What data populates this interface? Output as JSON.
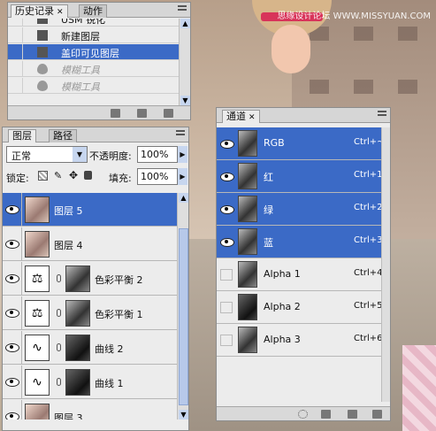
{
  "watermark": "思缘设计论坛 WWW.MISSYUAN.COM",
  "history": {
    "tabs": [
      "历史记录",
      "动作"
    ],
    "items": [
      {
        "label": "USM 锐化",
        "state": "normal"
      },
      {
        "label": "新建图层",
        "state": "normal"
      },
      {
        "label": "盖印可见图层",
        "state": "selected"
      },
      {
        "label": "模糊工具",
        "state": "dim"
      },
      {
        "label": "模糊工具",
        "state": "dim"
      }
    ]
  },
  "layers": {
    "tabs": [
      "图层",
      "路径"
    ],
    "blend_mode": "正常",
    "opacity_label": "不透明度:",
    "opacity_value": "100%",
    "lock_label": "锁定:",
    "fill_label": "填充:",
    "fill_value": "100%",
    "items": [
      {
        "name": "图层 5",
        "type": "photo",
        "selected": true
      },
      {
        "name": "图层 4",
        "type": "photo",
        "selected": false
      },
      {
        "name": "色彩平衡 2",
        "type": "adjust",
        "selected": false
      },
      {
        "name": "色彩平衡 1",
        "type": "adjust",
        "selected": false
      },
      {
        "name": "曲线 2",
        "type": "curve",
        "selected": false
      },
      {
        "name": "曲线 1",
        "type": "curve",
        "selected": false
      },
      {
        "name": "图层 3",
        "type": "photo",
        "selected": false
      }
    ]
  },
  "channels": {
    "tab": "通道",
    "items": [
      {
        "name": "RGB",
        "shortcut": "Ctrl+~",
        "selected": true
      },
      {
        "name": "红",
        "shortcut": "Ctrl+1",
        "selected": true
      },
      {
        "name": "绿",
        "shortcut": "Ctrl+2",
        "selected": true
      },
      {
        "name": "蓝",
        "shortcut": "Ctrl+3",
        "selected": true
      },
      {
        "name": "Alpha 1",
        "shortcut": "Ctrl+4",
        "selected": false
      },
      {
        "name": "Alpha 2",
        "shortcut": "Ctrl+5",
        "selected": false
      },
      {
        "name": "Alpha 3",
        "shortcut": "Ctrl+6",
        "selected": false
      }
    ]
  }
}
